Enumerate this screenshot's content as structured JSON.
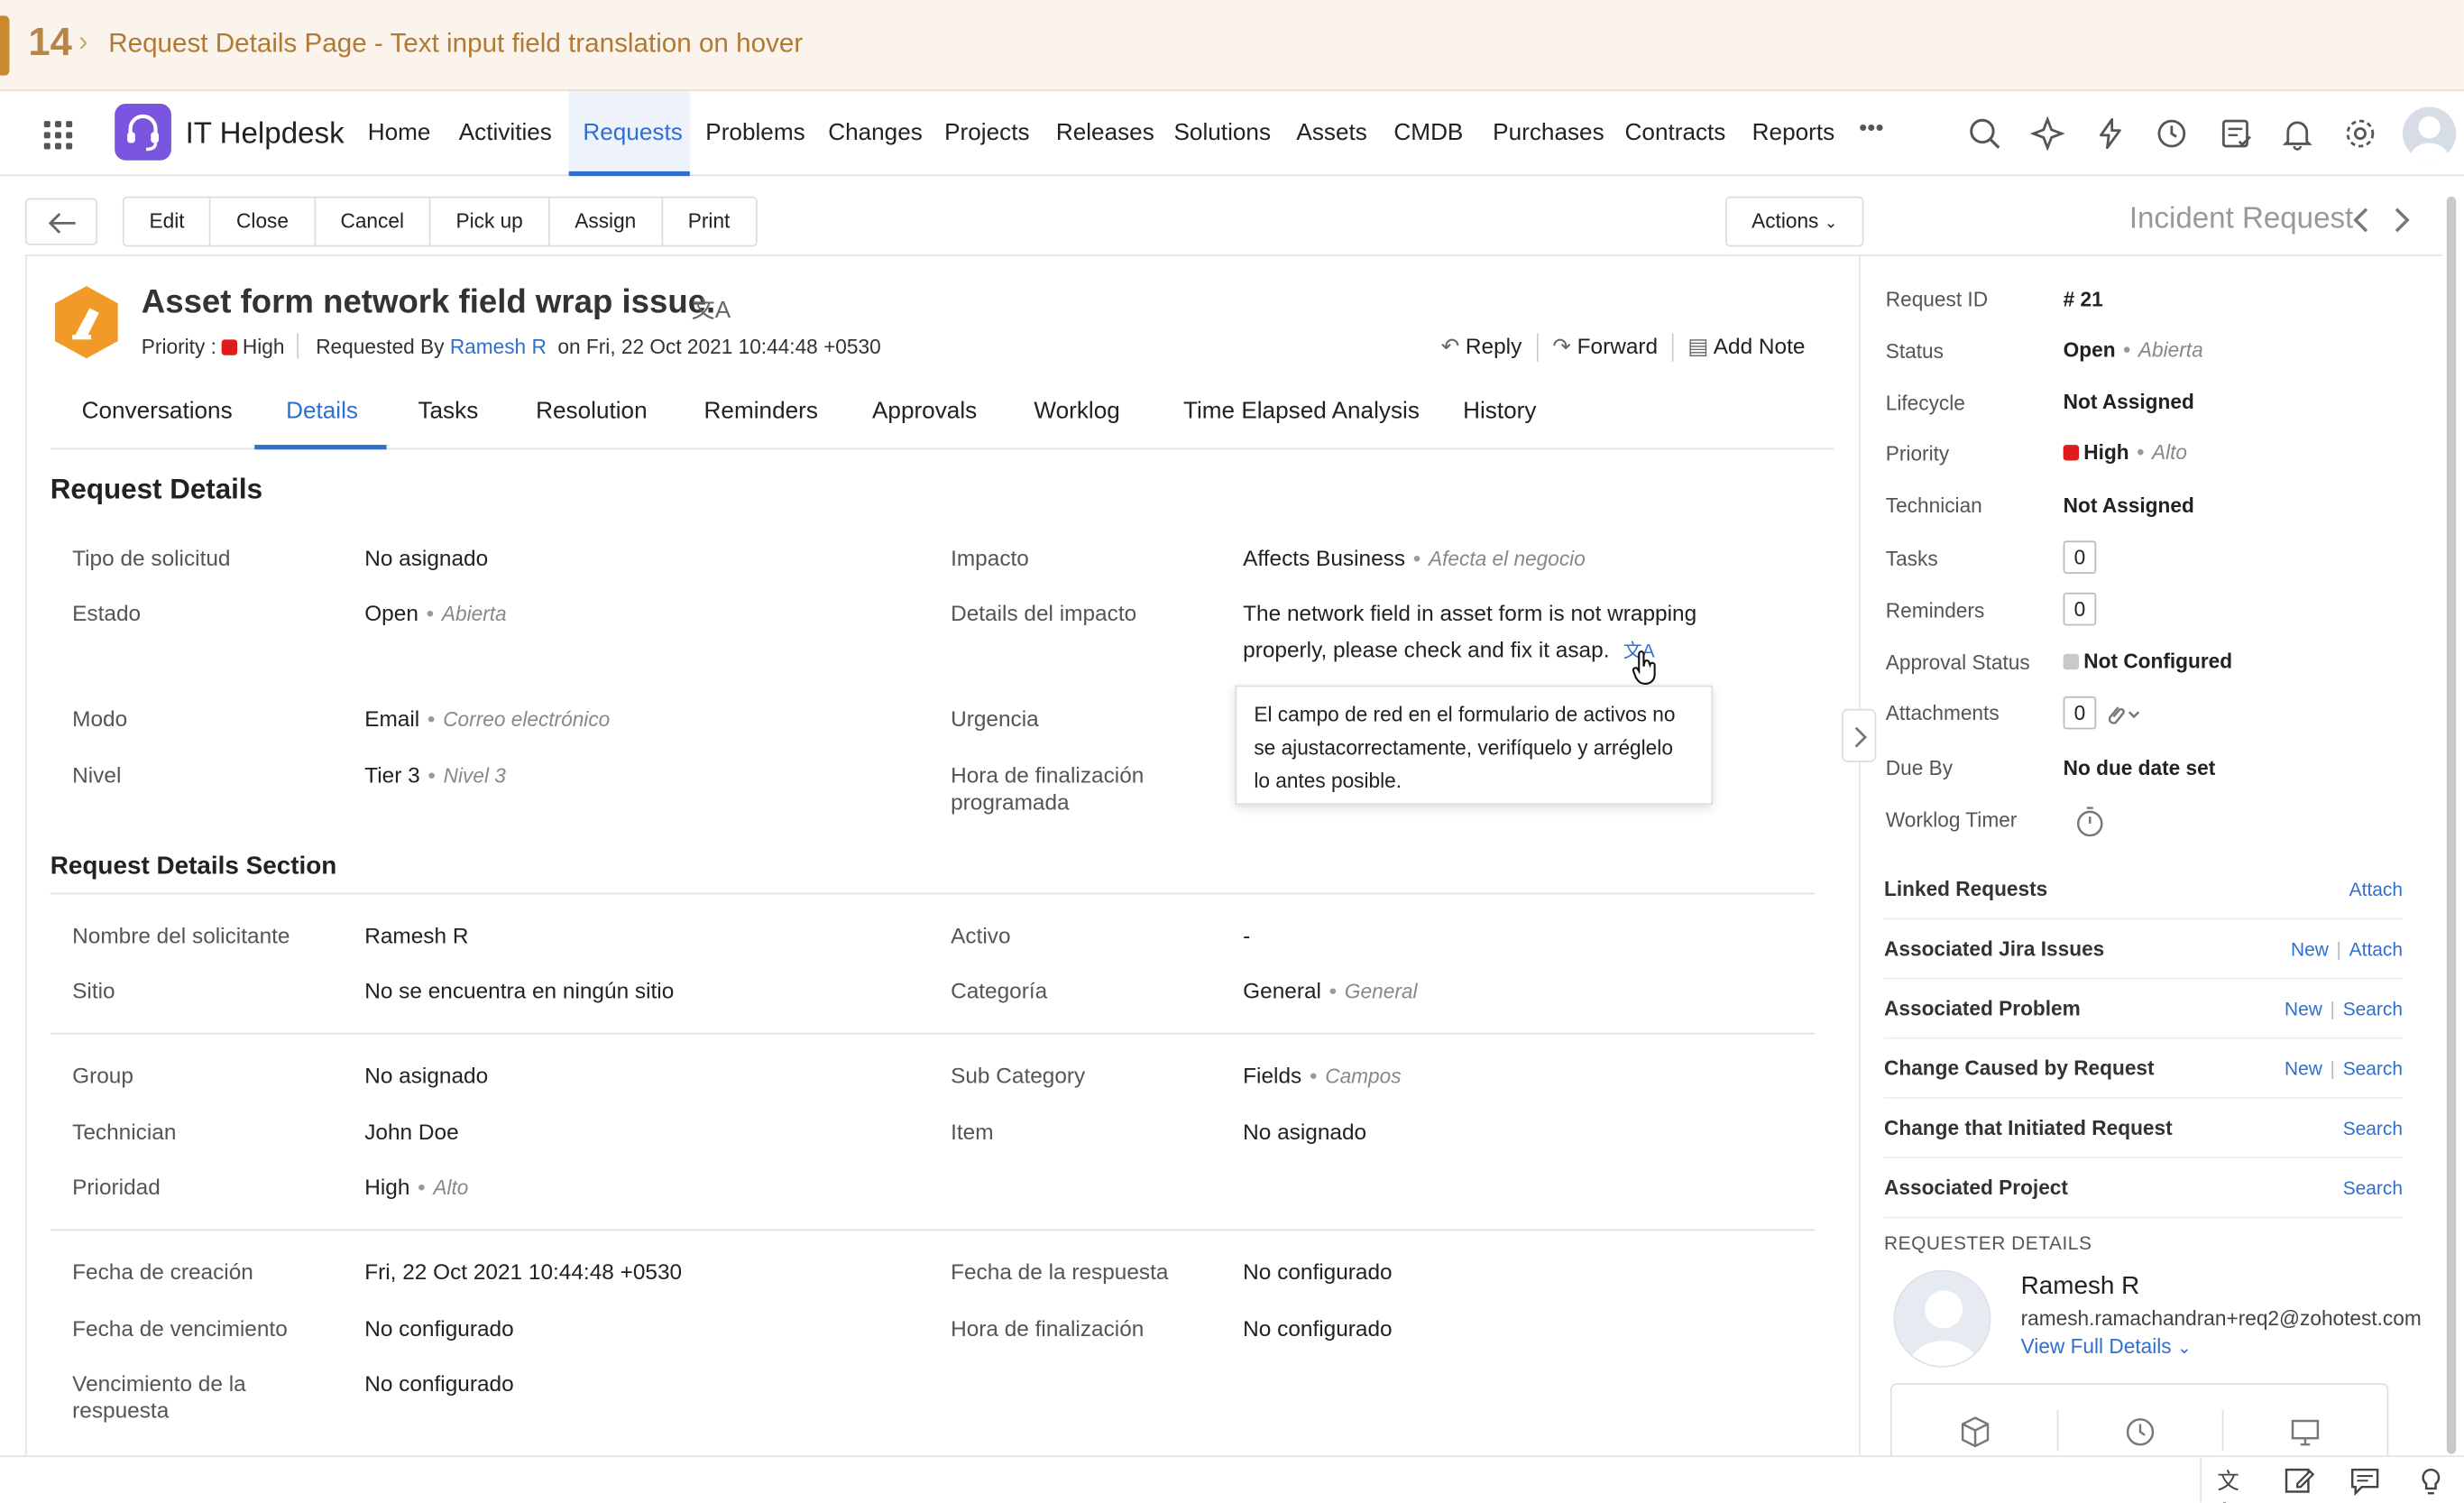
{
  "banner": {
    "step": "14",
    "title": "Request Details Page - Text input field translation on hover"
  },
  "app": {
    "title": "IT Helpdesk"
  },
  "nav": {
    "items": [
      "Home",
      "Activities",
      "Requests",
      "Problems",
      "Changes",
      "Projects",
      "Releases",
      "Solutions",
      "Assets",
      "CMDB",
      "Purchases",
      "Contracts",
      "Reports"
    ],
    "more": "•••"
  },
  "toolbar": {
    "buttons": [
      "Edit",
      "Close",
      "Cancel",
      "Pick up",
      "Assign",
      "Print"
    ],
    "actions": "Actions"
  },
  "request_type": "Incident Request",
  "request": {
    "subject": "Asset form network field wrap issue.",
    "priority_label": "Priority :",
    "priority": "High",
    "requested_by_label": "Requested By",
    "requester": "Ramesh R",
    "date_text": "on Fri, 22 Oct 2021 10:44:48 +0530"
  },
  "quick_actions": {
    "reply": "Reply",
    "forward": "Forward",
    "add_note": "Add Note"
  },
  "tabs": [
    "Conversations",
    "Details",
    "Tasks",
    "Resolution",
    "Reminders",
    "Approvals",
    "Worklog",
    "Time Elapsed Analysis",
    "History"
  ],
  "details": {
    "section1_title": "Request Details",
    "section2_title": "Request Details Section",
    "fields": {
      "tipo_label": "Tipo de solicitud",
      "tipo_value": "No asignado",
      "estado_label": "Estado",
      "estado_value": "Open",
      "estado_tr": "Abierta",
      "modo_label": "Modo",
      "modo_value": "Email",
      "modo_tr": "Correo electrónico",
      "nivel_label": "Nivel",
      "nivel_value": "Tier 3",
      "nivel_tr": "Nivel 3",
      "impacto_label": "Impacto",
      "impacto_value": "Affects Business",
      "impacto_tr": "Afecta el negocio",
      "details_impacto_label": "Details del impacto",
      "details_impacto_line1": "The network field in asset form is not wrapping",
      "details_impacto_line2": "properly, please check and fix it asap.",
      "urgencia_label": "Urgencia",
      "hora_prog_label1": "Hora de finalización",
      "hora_prog_label2": "programada",
      "nombre_label": "Nombre del solicitante",
      "nombre_value": "Ramesh R",
      "sitio_label": "Sitio",
      "sitio_value": "No se encuentra en ningún sitio",
      "activo_label": "Activo",
      "activo_value": "-",
      "categoria_label": "Categoría",
      "categoria_value": "General",
      "categoria_tr": "General",
      "group_label": "Group",
      "group_value": "No asignado",
      "technician_label": "Technician",
      "technician_value": "John Doe",
      "prioridad_label": "Prioridad",
      "prioridad_value": "High",
      "prioridad_tr": "Alto",
      "subcat_label": "Sub Category",
      "subcat_value": "Fields",
      "subcat_tr": "Campos",
      "item_label": "Item",
      "item_value": "No asignado",
      "creacion_label": "Fecha de creación",
      "creacion_value": "Fri, 22 Oct 2021 10:44:48 +0530",
      "vencimiento_label": "Fecha de vencimiento",
      "vencimiento_value": "No configurado",
      "venc_resp_label1": "Vencimiento de la",
      "venc_resp_label2": "respuesta",
      "venc_resp_value": "No configurado",
      "respuesta_label": "Fecha de la respuesta",
      "respuesta_value": "No configurado",
      "hora_fin_label": "Hora de finalización",
      "hora_fin_value": "No configurado"
    },
    "tooltip": {
      "line1": "El campo de red en el formulario de activos no",
      "line2": "se ajustacorrectamente, verifíquelo y arréglelo",
      "line3": "lo antes posible."
    }
  },
  "sidebar": {
    "request_id_label": "Request ID",
    "request_id": "# 21",
    "status_label": "Status",
    "status": "Open",
    "status_tr": "Abierta",
    "lifecycle_label": "Lifecycle",
    "lifecycle": "Not Assigned",
    "priority_label": "Priority",
    "priority": "High",
    "priority_tr": "Alto",
    "technician_label": "Technician",
    "technician": "Not Assigned",
    "tasks_label": "Tasks",
    "tasks": "0",
    "reminders_label": "Reminders",
    "reminders": "0",
    "approval_label": "Approval Status",
    "approval": "Not Configured",
    "attachments_label": "Attachments",
    "attachments": "0",
    "due_label": "Due By",
    "due": "No due date set",
    "worklog_label": "Worklog Timer",
    "links": [
      {
        "title": "Linked Requests",
        "a1": "",
        "a2": "Attach"
      },
      {
        "title": "Associated Jira Issues",
        "a1": "New",
        "a2": "Attach"
      },
      {
        "title": "Associated Problem",
        "a1": "New",
        "a2": "Search"
      },
      {
        "title": "Change Caused by Request",
        "a1": "New",
        "a2": "Search"
      },
      {
        "title": "Change that Initiated Request",
        "a1": "",
        "a2": "Search"
      },
      {
        "title": "Associated Project",
        "a1": "",
        "a2": "Search"
      }
    ],
    "requester_heading": "REQUESTER DETAILS",
    "requester_name": "Ramesh R",
    "requester_email": "ramesh.ramachandran+req2@zohotest.com",
    "view_full": "View Full Details"
  },
  "colors": {
    "accent": "#2f6fd0",
    "high": "#e01b1b",
    "banner_text": "#b07a34"
  }
}
